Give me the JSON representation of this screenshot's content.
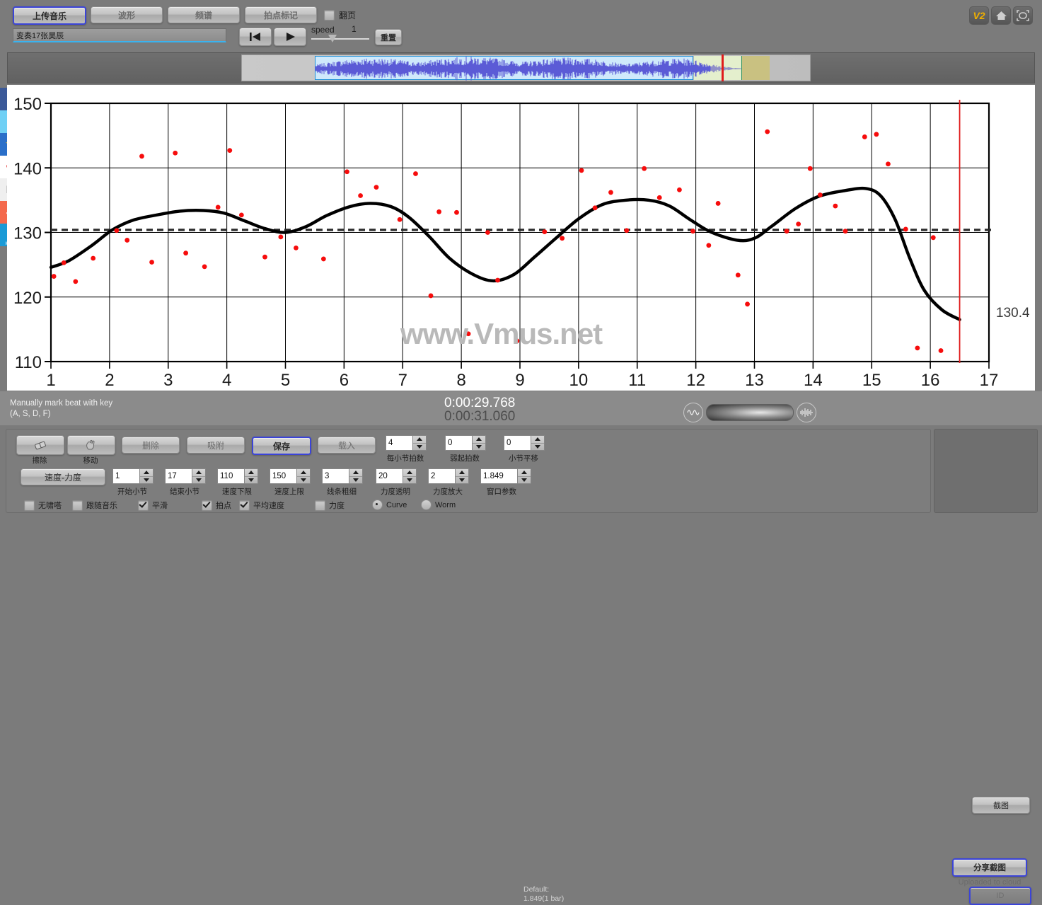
{
  "toolbar": {
    "tabs": [
      {
        "label": "上传音乐",
        "active": true
      },
      {
        "label": "波形",
        "active": false
      },
      {
        "label": "频谱",
        "active": false
      },
      {
        "label": "拍点标记",
        "active": false
      }
    ],
    "flip_page": {
      "label": "翻页",
      "checked": false
    },
    "title_field": {
      "value": "变奏17张昊辰",
      "placeholder": ""
    },
    "transport": {
      "prev_icon": "skip-back-icon",
      "play_icon": "play-icon"
    },
    "speed": {
      "label": "speed",
      "value": "1"
    },
    "reset_label": "重置",
    "right_icons": [
      {
        "name": "v2-badge-icon",
        "label": "V2"
      },
      {
        "name": "home-icon",
        "label": ""
      },
      {
        "name": "fullscreen-icon",
        "label": ""
      }
    ]
  },
  "social": [
    {
      "name": "facebook-icon",
      "glyph": "f"
    },
    {
      "name": "twitter-icon",
      "glyph": "t"
    },
    {
      "name": "qzone-icon",
      "glyph": "★"
    },
    {
      "name": "weibo-icon",
      "glyph": "❀"
    },
    {
      "name": "email-icon",
      "glyph": "✉"
    },
    {
      "name": "more-share-icon",
      "glyph": "＋"
    },
    {
      "name": "help-icon",
      "glyph": "?",
      "sub": "HELP"
    }
  ],
  "chart_data": {
    "type": "scatter",
    "title": "",
    "xlabel": "",
    "ylabel": "",
    "xlim": [
      1,
      17
    ],
    "ylim": [
      110,
      150
    ],
    "xticks": [
      1,
      2,
      3,
      4,
      5,
      6,
      7,
      8,
      9,
      10,
      11,
      12,
      13,
      14,
      15,
      16,
      17
    ],
    "yticks": [
      110,
      120,
      130,
      140,
      150
    ],
    "grid": true,
    "watermark": "www.Vmus.net",
    "mean_line": {
      "value": 130.4,
      "label": "130.4",
      "style": "dashed"
    },
    "playhead_x": 16.5,
    "series": [
      {
        "name": "beat-tempo-points",
        "type": "scatter",
        "color": "#f60c0c",
        "points": [
          [
            1.05,
            123.2
          ],
          [
            1.22,
            125.3
          ],
          [
            1.42,
            122.4
          ],
          [
            1.72,
            126.0
          ],
          [
            2.12,
            130.3
          ],
          [
            2.3,
            128.8
          ],
          [
            2.55,
            141.8
          ],
          [
            2.72,
            125.4
          ],
          [
            3.12,
            142.3
          ],
          [
            3.3,
            126.8
          ],
          [
            3.62,
            124.7
          ],
          [
            3.85,
            133.9
          ],
          [
            4.05,
            142.7
          ],
          [
            4.25,
            132.7
          ],
          [
            4.65,
            126.2
          ],
          [
            4.92,
            129.3
          ],
          [
            5.18,
            127.6
          ],
          [
            5.65,
            125.9
          ],
          [
            6.05,
            139.4
          ],
          [
            6.28,
            135.7
          ],
          [
            6.55,
            137.0
          ],
          [
            6.95,
            132.0
          ],
          [
            7.22,
            139.1
          ],
          [
            7.48,
            120.2
          ],
          [
            7.62,
            133.2
          ],
          [
            7.92,
            133.1
          ],
          [
            8.12,
            114.3
          ],
          [
            8.45,
            130.0
          ],
          [
            8.62,
            122.6
          ],
          [
            8.95,
            113.2
          ],
          [
            9.42,
            130.1
          ],
          [
            9.72,
            129.1
          ],
          [
            10.05,
            139.6
          ],
          [
            10.28,
            133.8
          ],
          [
            10.55,
            136.2
          ],
          [
            10.82,
            130.3
          ],
          [
            11.12,
            139.9
          ],
          [
            11.38,
            135.4
          ],
          [
            11.72,
            136.6
          ],
          [
            11.95,
            130.2
          ],
          [
            12.22,
            128.0
          ],
          [
            12.38,
            134.5
          ],
          [
            12.72,
            123.4
          ],
          [
            12.88,
            118.9
          ],
          [
            13.22,
            145.6
          ],
          [
            13.55,
            130.2
          ],
          [
            13.75,
            131.3
          ],
          [
            13.95,
            139.9
          ],
          [
            14.12,
            135.8
          ],
          [
            14.38,
            134.1
          ],
          [
            14.55,
            130.2
          ],
          [
            14.88,
            144.8
          ],
          [
            15.08,
            145.2
          ],
          [
            15.28,
            140.6
          ],
          [
            15.58,
            130.5
          ],
          [
            15.78,
            112.1
          ],
          [
            16.05,
            129.2
          ],
          [
            16.18,
            111.7
          ]
        ]
      },
      {
        "name": "smoothed-tempo-curve",
        "type": "line",
        "color": "#000000",
        "points": [
          [
            1.0,
            124.6
          ],
          [
            1.3,
            125.6
          ],
          [
            1.7,
            128.0
          ],
          [
            2.05,
            130.4
          ],
          [
            2.4,
            131.9
          ],
          [
            2.8,
            132.7
          ],
          [
            3.2,
            133.3
          ],
          [
            3.6,
            133.4
          ],
          [
            3.95,
            133.0
          ],
          [
            4.3,
            131.8
          ],
          [
            4.65,
            130.6
          ],
          [
            5.0,
            130.0
          ],
          [
            5.35,
            130.9
          ],
          [
            5.7,
            132.6
          ],
          [
            6.1,
            134.0
          ],
          [
            6.45,
            134.5
          ],
          [
            6.8,
            134.0
          ],
          [
            7.1,
            132.4
          ],
          [
            7.45,
            129.4
          ],
          [
            7.8,
            126.0
          ],
          [
            8.2,
            123.5
          ],
          [
            8.55,
            122.5
          ],
          [
            8.9,
            123.5
          ],
          [
            9.25,
            126.2
          ],
          [
            9.6,
            129.0
          ],
          [
            10.0,
            132.1
          ],
          [
            10.4,
            134.3
          ],
          [
            10.8,
            135.0
          ],
          [
            11.2,
            135.0
          ],
          [
            11.55,
            134.1
          ],
          [
            11.9,
            132.0
          ],
          [
            12.25,
            130.1
          ],
          [
            12.7,
            128.8
          ],
          [
            13.0,
            129.1
          ],
          [
            13.3,
            131.0
          ],
          [
            13.7,
            133.7
          ],
          [
            14.1,
            135.6
          ],
          [
            14.55,
            136.5
          ],
          [
            14.9,
            136.8
          ],
          [
            15.15,
            135.7
          ],
          [
            15.4,
            132.0
          ],
          [
            15.65,
            126.0
          ],
          [
            15.9,
            121.0
          ],
          [
            16.2,
            118.0
          ],
          [
            16.5,
            116.5
          ]
        ]
      }
    ]
  },
  "info": {
    "hint_line1": "Manually mark beat with key",
    "hint_line2": "(A, S, D, F)",
    "time_current": "0:00:29.768",
    "time_total": "0:00:31.060",
    "volume_left_icon": "waveform-low-icon",
    "volume_right_icon": "waveform-high-icon",
    "screenshot_label": "截图"
  },
  "bottom": {
    "tools": [
      {
        "label": "擦除",
        "icon": "eraser-icon"
      },
      {
        "label": "移动",
        "icon": "hand-move-icon"
      }
    ],
    "wide_buttons": [
      {
        "label": "删除",
        "focus": false
      },
      {
        "label": "吸附",
        "focus": false
      },
      {
        "label": "保存",
        "focus": true
      },
      {
        "label": "载入",
        "focus": false
      }
    ],
    "mode_button": {
      "label": "速度-力度"
    },
    "spinners_row_top": [
      {
        "label": "每小节拍数",
        "value": "4"
      },
      {
        "label": "弱起拍数",
        "value": "0"
      },
      {
        "label": "小节平移",
        "value": "0"
      }
    ],
    "spinners_row_bottom": [
      {
        "label": "开始小节",
        "value": "1"
      },
      {
        "label": "结束小节",
        "value": "17"
      },
      {
        "label": "速度下限",
        "value": "110"
      },
      {
        "label": "速度上限",
        "value": "150"
      },
      {
        "label": "线条粗细",
        "value": "3"
      },
      {
        "label": "力度透明",
        "value": "20"
      },
      {
        "label": "力度放大",
        "value": "2"
      },
      {
        "label": "窗口参数",
        "value": "1.849"
      }
    ],
    "default_note_line1": "Default:",
    "default_note_line2": "1.849(1 bar)",
    "checkboxes": [
      {
        "label": "无啸嗒",
        "checked": false
      },
      {
        "label": "跟随音乐",
        "checked": false
      },
      {
        "label": "平滑",
        "checked": true
      },
      {
        "label": "拍点",
        "checked": true
      },
      {
        "label": "平均速度",
        "checked": true
      },
      {
        "label": "力度",
        "checked": false
      }
    ],
    "radios": [
      {
        "label": "Curve",
        "checked": true
      },
      {
        "label": "Worm",
        "checked": false
      }
    ],
    "share": {
      "share_label": "分享截图",
      "uploaded_label": "Uploaded to cloud",
      "id_label": "ID"
    }
  },
  "colors": {
    "accent_focus": "#3b44d8",
    "point_red": "#f60c0c",
    "playhead_red": "#e01b1b",
    "panel_gray": "#7b7b7b"
  }
}
